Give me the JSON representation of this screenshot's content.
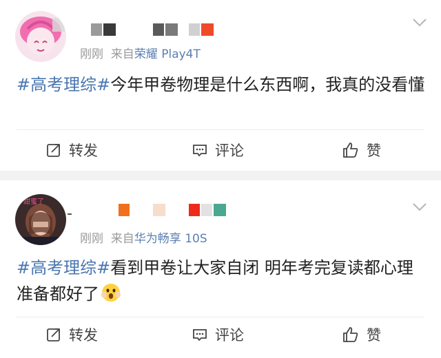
{
  "posts": [
    {
      "meta": {
        "time": "刚刚",
        "from_prefix": "来自",
        "source": "荣耀 Play4T"
      },
      "content": {
        "tag": "#高考理综#",
        "text": "今年甲卷物理是什么东西啊，我真的没看懂",
        "emoji": ""
      },
      "actions": {
        "repost": "转发",
        "comment": "评论",
        "like": "赞"
      }
    },
    {
      "meta": {
        "time": "刚刚",
        "from_prefix": "来自",
        "source": "华为畅享 10S"
      },
      "content": {
        "tag": "#高考理综#",
        "text": "看到甲卷让大家自闭 明年考完复读都心理准备都好了",
        "emoji": "scared-face"
      },
      "actions": {
        "repost": "转发",
        "comment": "评论",
        "like": "赞"
      }
    }
  ],
  "icons": {
    "repost": "repost-icon",
    "comment": "comment-icon",
    "like": "thumbs-up-icon",
    "menu": "chevron-down-icon"
  },
  "colors": {
    "topic_link": "#4a77b0",
    "source_link": "#5b7fb0",
    "meta_gray": "#9a9a9a",
    "separator": "#f2f2f2"
  }
}
